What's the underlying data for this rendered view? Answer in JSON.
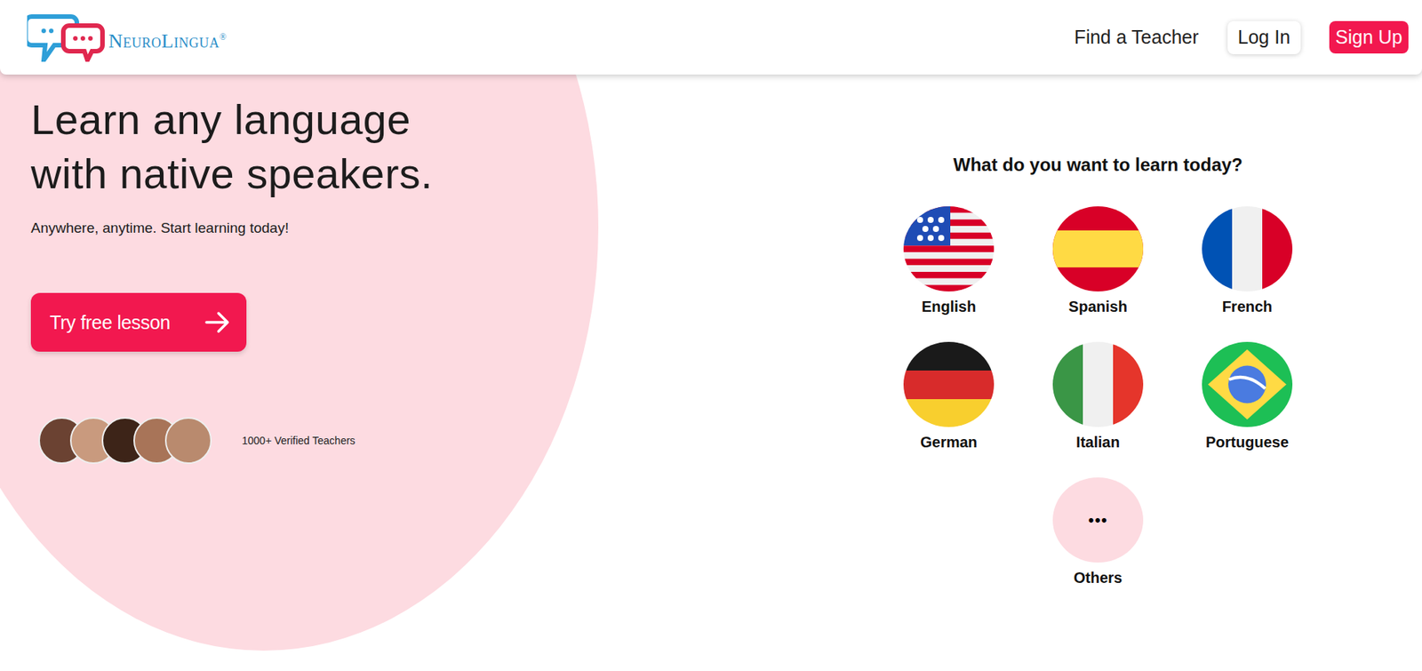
{
  "header": {
    "logo": {
      "text": "NeuroLingua",
      "mark": "®"
    },
    "nav": [
      {
        "label": "Find a Teacher",
        "kind": "link"
      },
      {
        "label": "Log In",
        "kind": "outline"
      },
      {
        "label": "Sign Up",
        "kind": "primary"
      }
    ]
  },
  "hero": {
    "title_lines": [
      "Learn any language",
      "with native speakers."
    ],
    "subtitle": "Anywhere, anytime. Start learning today!",
    "cta": "Try free lesson",
    "teachers": "1000+ Verified Teachers"
  },
  "picker": {
    "title": "What do you want to learn today?",
    "languages": [
      {
        "name": "English",
        "kind": "us"
      },
      {
        "name": "Spanish",
        "kind": "es"
      },
      {
        "name": "French",
        "kind": "fr"
      },
      {
        "name": "German",
        "kind": "de"
      },
      {
        "name": "Italian",
        "kind": "it"
      },
      {
        "name": "Portuguese",
        "kind": "br"
      },
      {
        "name": "Others",
        "kind": "more",
        "icon": "•••"
      }
    ]
  }
}
